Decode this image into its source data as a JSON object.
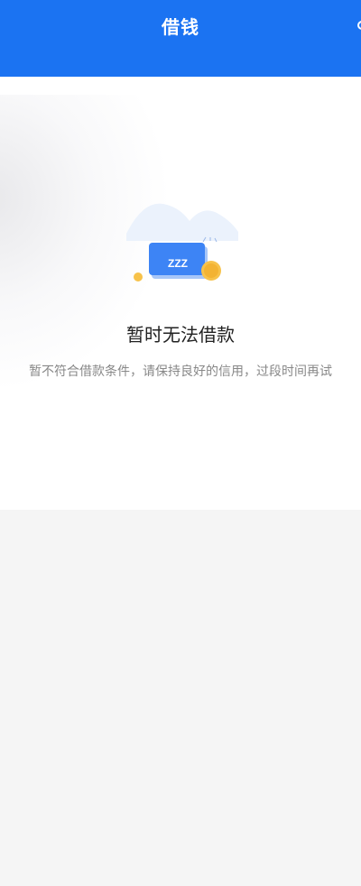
{
  "header": {
    "title": "借钱",
    "more_icon": "more-icon"
  },
  "empty_state": {
    "illustration_icon": "sleeping-card-icon",
    "sleep_text": "ZZZ",
    "title": "暂时无法借款",
    "subtitle": "暂不符合借款条件，请保持良好的信用，过段时间再试"
  },
  "colors": {
    "header_bg": "#1b73f2",
    "card_blue": "#3d84f5",
    "coin_yellow": "#f7c24a",
    "page_bg": "#f5f5f5"
  }
}
